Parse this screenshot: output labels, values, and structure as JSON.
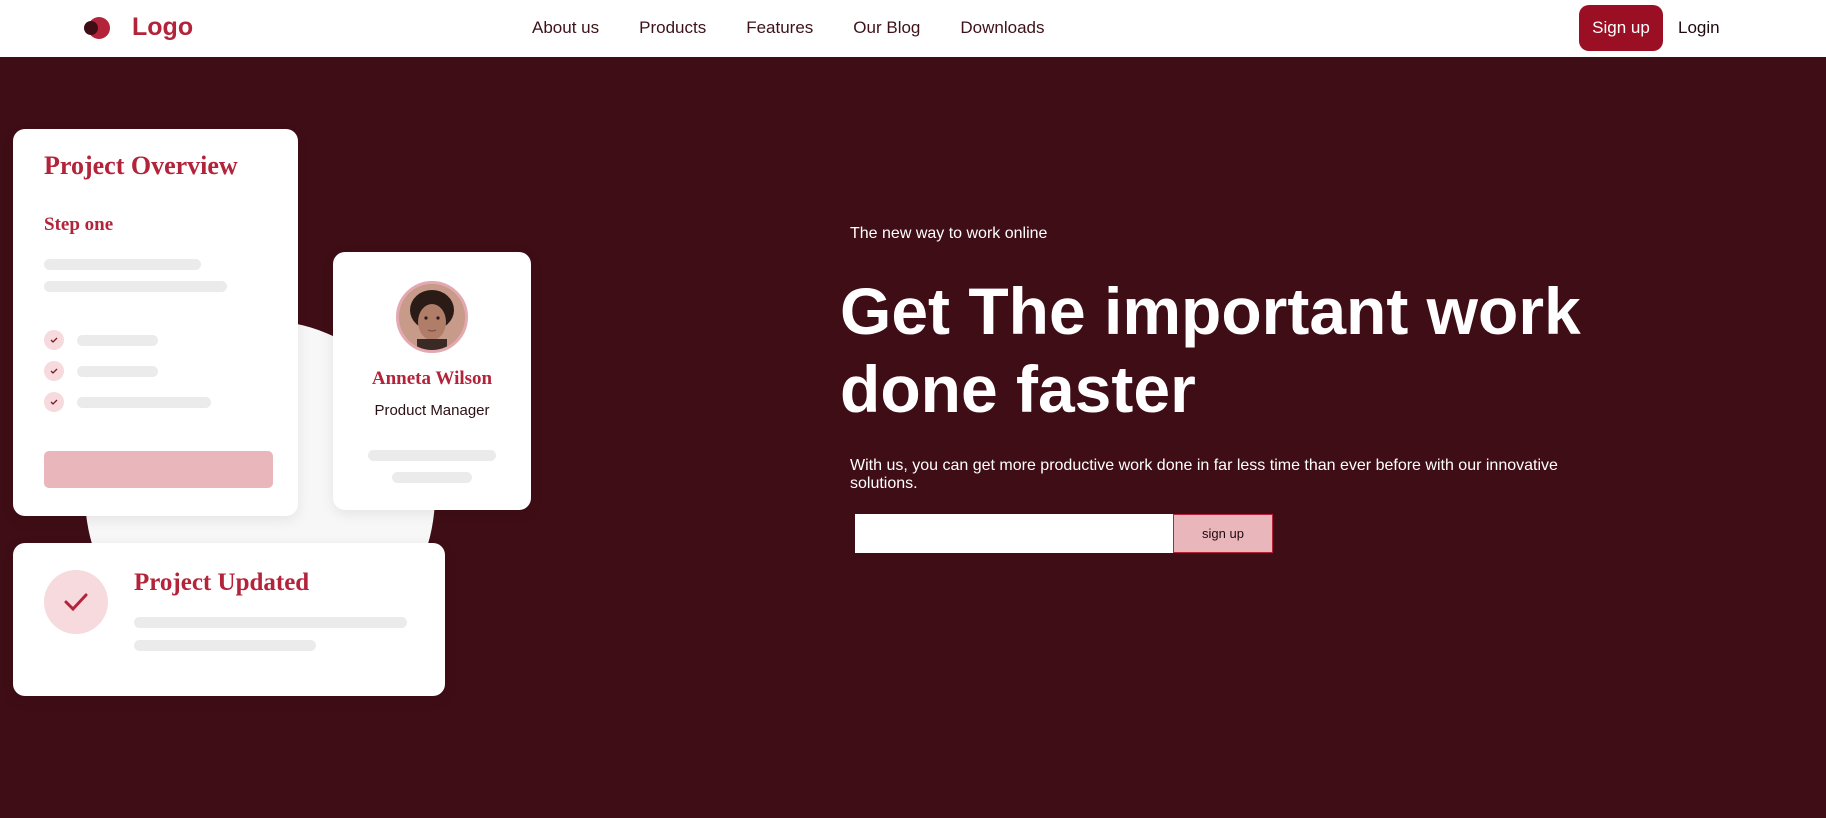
{
  "nav": {
    "logo_text": "Logo",
    "links": [
      "About us",
      "Products",
      "Features",
      "Our Blog",
      "Downloads"
    ],
    "signup_label": "Sign up",
    "login_label": "Login"
  },
  "overview_card": {
    "title": "Project Overview",
    "step": "Step one"
  },
  "person_card": {
    "name": "Anneta Wilson",
    "role": "Product Manager"
  },
  "updated_card": {
    "title": "Project Updated"
  },
  "hero": {
    "tagline": "The new way to work online",
    "headline": "Get The important work done faster",
    "description": "With us, you can get more productive work done in far less time than ever before with our innovative solutions.",
    "email_value": "",
    "email_placeholder": "",
    "button_label": "sign up"
  },
  "colors": {
    "brand": "#b3233a",
    "background": "#3f0d16",
    "cta": "#9b0f24",
    "soft_pink": "#e8b6bb"
  }
}
